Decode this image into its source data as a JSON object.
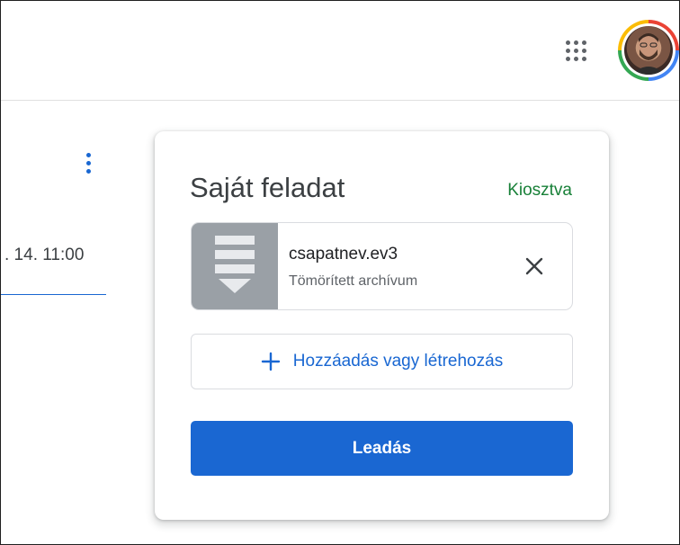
{
  "header": {
    "apps_icon": "apps-grid-icon",
    "avatar_icon": "user-avatar"
  },
  "stream": {
    "due_text": ". 14. 11:00",
    "more_icon": "more-vert-icon"
  },
  "work_card": {
    "title": "Saját feladat",
    "status": "Kiosztva",
    "status_color": "#188038",
    "attachment": {
      "name": "csapatnev.ev3",
      "type": "Tömörített archívum",
      "icon": "archive-file-icon",
      "remove_icon": "close-icon"
    },
    "add_label": "Hozzáadás vagy létrehozás",
    "add_icon": "plus-icon",
    "submit_label": "Leadás",
    "accent_color": "#1a67d2"
  }
}
